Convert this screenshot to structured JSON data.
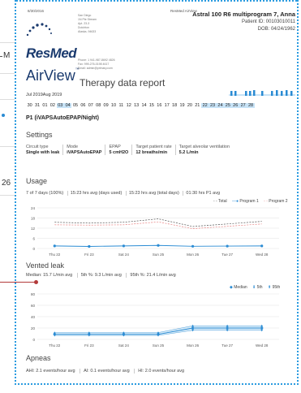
{
  "side": {
    "m_label": "M",
    "num_label": "26"
  },
  "header": {
    "date": "8/30/2016",
    "app": "ResMed AirView",
    "patient_name": "Astral 100 R6 multiprogram 7, Anna",
    "patient_id": "Patient ID: 00103010011",
    "dob": "DOB: 04/24/1962",
    "address": [
      "San Diego",
      "1N Pte Stream",
      "Apt. 23-3",
      "Dutchton",
      "Alaska, 94633"
    ],
    "contact": [
      "Phone: 1 941-987-8692 4826",
      "Fax: 999-276-0198 4617",
      "Email: admin@primary.com"
    ],
    "logo": "ResMed",
    "airview": "AirView",
    "tm": "™",
    "report_title": "Therapy data report",
    "month_range": "Jul 2019Aug 2019"
  },
  "days": {
    "items": [
      "30",
      "31",
      "01",
      "02",
      "03",
      "04",
      "05",
      "06",
      "07",
      "08",
      "09",
      "10",
      "11",
      "12",
      "13",
      "14",
      "15",
      "16",
      "17",
      "18",
      "19",
      "20",
      "21",
      "22",
      "23",
      "24",
      "25",
      "26",
      "27",
      "28"
    ],
    "highlighted": [
      "03",
      "04",
      "22",
      "23",
      "24",
      "25",
      "26",
      "27",
      "28"
    ]
  },
  "program": "P1 (iVAPSAutoEPAP/Night)",
  "settings": {
    "title": "Settings",
    "items": [
      {
        "label": "Circuit type",
        "value": "Single with leak"
      },
      {
        "label": "Mode",
        "value": "iVAPSAutoEPAP"
      },
      {
        "label": "EPAP",
        "value": "5 cmH2O"
      },
      {
        "label": "Target patient rate",
        "value": "12 breaths/min"
      },
      {
        "label": "Target alveolar ventilation",
        "value": "5.2 L/min"
      }
    ]
  },
  "usage": {
    "title": "Usage",
    "stats": [
      "7 of 7 days (100%)",
      "15:23 hrs avg (days used)",
      "15:23 hrs avg (total days)",
      "01:30 hrs P1 avg"
    ],
    "legend": [
      "Total",
      "Program 1",
      "Program 2"
    ]
  },
  "vented_leak": {
    "title": "Vented leak",
    "stats": [
      "Median: 15.7 L/min avg",
      "5th %: 9.3 L/min avg",
      "95th %: 21.4 L/min avg"
    ],
    "legend": [
      "Median",
      "5th",
      "95th"
    ]
  },
  "apneas": {
    "title": "Apneas",
    "stats": [
      "AHI: 2.1 events/hour avg",
      "AI: 0.1 events/hour avg",
      "HI: 2.0 events/hour avg"
    ]
  },
  "chart_data": [
    {
      "type": "line",
      "title": "Usage",
      "categories": [
        "Thu 22",
        "Fri 23",
        "Sat 24",
        "Sun 25",
        "Mon 26",
        "Tue 27",
        "Wed 28"
      ],
      "yticks": [
        0,
        6,
        12,
        18,
        24
      ],
      "ylim": [
        0,
        24
      ],
      "series": [
        {
          "name": "Total",
          "values": [
            15.5,
            15.0,
            15.5,
            17.5,
            13.0,
            14.5,
            16.0
          ]
        },
        {
          "name": "Program 1",
          "values": [
            1.5,
            1.2,
            1.5,
            1.8,
            1.3,
            1.4,
            1.5
          ]
        },
        {
          "name": "Program 2",
          "values": [
            14.0,
            13.8,
            14.0,
            15.7,
            11.7,
            13.1,
            14.5
          ]
        }
      ],
      "colors": {
        "Total": "#555555",
        "Program 1": "#2a8bd3",
        "Program 2": "#e88080"
      }
    },
    {
      "type": "line",
      "title": "Vented leak",
      "categories": [
        "Thu 22",
        "Fri 23",
        "Sat 24",
        "Sun 25",
        "Mon 26",
        "Tue 27",
        "Wed 28"
      ],
      "yticks": [
        0,
        20,
        40,
        60,
        80
      ],
      "ylim": [
        0,
        80
      ],
      "series": [
        {
          "name": "Median",
          "values": [
            9,
            9,
            9,
            9,
            20,
            20,
            20
          ]
        },
        {
          "name": "5th",
          "values": [
            7,
            7,
            7,
            7,
            16,
            16,
            16
          ]
        },
        {
          "name": "95th",
          "values": [
            12,
            12,
            12,
            12,
            24,
            24,
            24
          ]
        }
      ],
      "colors": {
        "Median": "#2a8bd3",
        "5th": "#2a8bd3",
        "95th": "#2a8bd3"
      }
    }
  ]
}
